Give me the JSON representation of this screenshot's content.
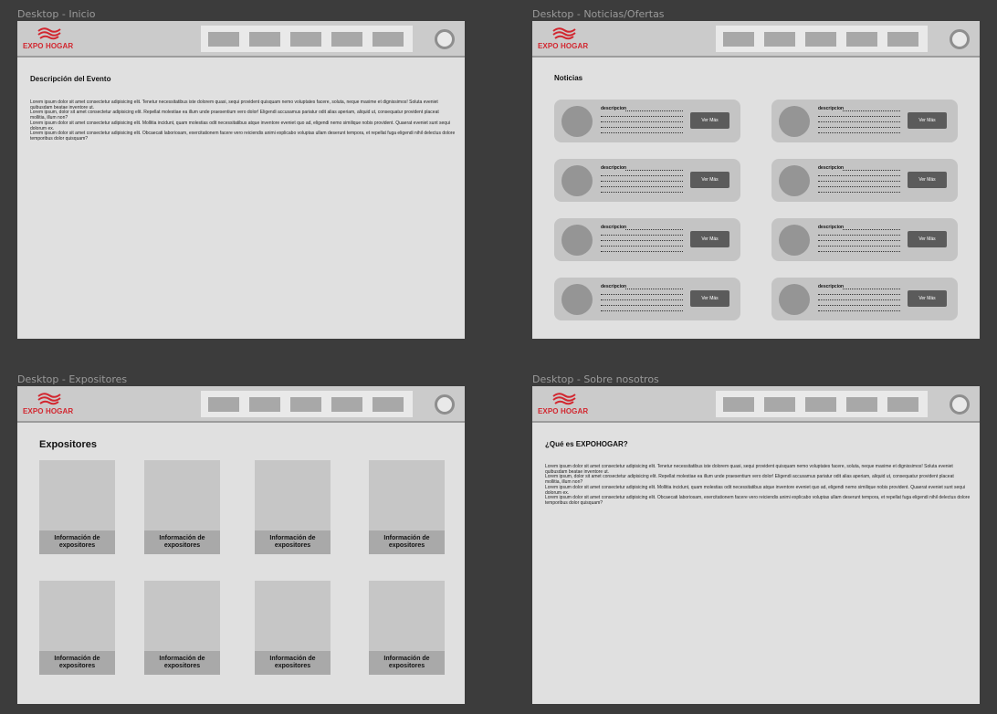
{
  "brand": {
    "logo_text": "EXPO HOGAR",
    "accent": "#d2262f"
  },
  "frames": {
    "inicio": {
      "label": "Desktop - Inicio",
      "heading": "Descripción del Evento",
      "paragraphs": [
        "Lorem ipsum dolor sit amet consectetur adipisicing elit. Tenetur necessitatibus iste dolorem quasi, sequi provident quisquam nemo voluptates facere, soluta, neque maxime et dignissimos! Soluta eveniet quibusdam beatae inventore ut.",
        "Lorem ipsum, dolor sit amet consectetur adipisicing elit. Repellat molestiae ea illum unde praesentium vero dolor! Eligendi accusamus pariatur odit alias aperiam, aliquid ut, consequatur provident placeat mollitia, illum non?",
        "Lorem ipsum dolor sit amet consectetur adipisicing elit. Mollitia incidunt, quam molestias odit necessitatibus atque inventore eveniet quo ad, eligendi nemo similique nobis provident. Quaerat eveniet sunt sequi dolorum ex.",
        "Lorem ipsum dolor sit amet consectetur adipisicing elit. Obcaecati laboriosam, exercitationem facere vero reiciendis animi explicabo voluptas ullam deserunt tempora, et repellat fuga eligendi nihil delectus dolore temporibus dolor quisquam?"
      ]
    },
    "noticias": {
      "label": "Desktop - Noticias/Ofertas",
      "heading": "Noticias",
      "cards": [
        {
          "desc": "descripcion",
          "button": "Ver Más"
        },
        {
          "desc": "descripcion",
          "button": "Ver Más"
        },
        {
          "desc": "descripcion",
          "button": "Ver Más"
        },
        {
          "desc": "descripcion",
          "button": "Ver Más"
        },
        {
          "desc": "descripcion",
          "button": "Ver Más"
        },
        {
          "desc": "descripcion",
          "button": "Ver Más"
        },
        {
          "desc": "descripcion",
          "button": "Ver Más"
        },
        {
          "desc": "descripcion",
          "button": "Ver Más"
        }
      ]
    },
    "expositores": {
      "label": "Desktop - Expositores",
      "heading": "Expositores",
      "cards": [
        {
          "info": "Información de expositores"
        },
        {
          "info": "Información de expositores"
        },
        {
          "info": "Información de expositores"
        },
        {
          "info": "Información de expositores"
        },
        {
          "info": "Información de expositores"
        },
        {
          "info": "Información de expositores"
        },
        {
          "info": "Información de expositores"
        },
        {
          "info": "Información de expositores"
        }
      ]
    },
    "sobre": {
      "label": "Desktop - Sobre nosotros",
      "heading": "¿Qué es EXPOHOGAR?",
      "paragraphs": [
        "Lorem ipsum dolor sit amet consectetur adipisicing elit. Tenetur necessitatibus iste dolorem quasi, sequi provident quisquam nemo voluptates facere, soluta, neque maxime et dignissimos! Soluta eveniet quibusdam beatae inventore ut.",
        "Lorem ipsum, dolor sit amet consectetur adipisicing elit. Repellat molestiae ea illum unde praesentium vero dolor! Eligendi accusamus pariatur odit alias aperiam, aliquid ut, consequatur provident placeat mollitia, illum non?",
        "Lorem ipsum dolor sit amet consectetur adipisicing elit. Mollitia incidunt, quam molestias odit necessitatibus atque inventore eveniet quo ad, eligendi nemo similique nobis provident. Quaerat eveniet sunt sequi dolorum ex.",
        "Lorem ipsum dolor sit amet consectetur adipisicing elit. Obcaecati laboriosam, exercitationem facere vero reiciendis animi explicabo voluptas ullam deserunt tempora, et repellat fuga eligendi nihil delectus dolore temporibus dolor quisquam?"
      ]
    }
  },
  "icons": {
    "logo": "wave-logo-icon",
    "profile": "avatar-circle-icon"
  }
}
